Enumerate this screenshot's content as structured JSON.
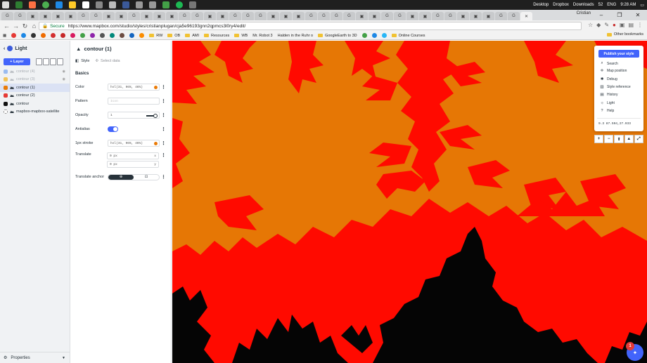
{
  "taskbar": {
    "desktop": "Desktop",
    "dropbox": "Dropbox",
    "downloads": "Downloads",
    "battery": "52",
    "lang": "ENG",
    "time": "9:28 AM"
  },
  "browser": {
    "window_name": "Cristian",
    "secure_label": "Secure",
    "url": "https://www.mapbox.com/studio/styles/cristianplugan/cja5e96193gnn2qpmcs3l0ry4/edit/",
    "bookmarks": [
      "RW",
      "OB",
      "AMI",
      "Resources",
      "WB",
      "Mr. Robot 3",
      "Halden in the Ruhr o",
      "GoogleEarth to 3D",
      "Online Courses"
    ],
    "other_bookmarks": "Other bookmarks"
  },
  "left_panel": {
    "title": "Light",
    "add_layer": "+ Layer",
    "layers": [
      {
        "name": "contour (4)",
        "color": "#9bbcf0",
        "dim": true,
        "selected": false
      },
      {
        "name": "contour (3)",
        "color": "#f2c45a",
        "dim": true,
        "selected": false
      },
      {
        "name": "contour (1)",
        "color": "#e97b07",
        "dim": false,
        "selected": true
      },
      {
        "name": "contour (2)",
        "color": "#e53935",
        "dim": false,
        "selected": false
      },
      {
        "name": "contour",
        "color": "#111111",
        "dim": false,
        "selected": false
      },
      {
        "name": "mapbox-mapbox-satellite",
        "color": "#ffffff",
        "dim": false,
        "selected": false
      }
    ],
    "footer": "Properties"
  },
  "editor": {
    "layer_title": "contour (1)",
    "tab_style": "Style",
    "tab_select": "Select data",
    "section": "Basics",
    "color_label": "Color",
    "color_value": "hsl(31, 96%, 46%)",
    "pattern_label": "Pattern",
    "pattern_placeholder": "Icon",
    "opacity_label": "Opacity",
    "opacity_value": "1",
    "antialias_label": "Antialias",
    "stroke_label": "1px stroke",
    "stroke_value": "hsl(31, 96%, 46%)",
    "translate_label": "Translate",
    "translate_x": "0 px",
    "translate_x_axis": "x",
    "translate_y": "0 px",
    "translate_y_axis": "y",
    "anchor_label": "Translate anchor"
  },
  "map_panel": {
    "publish": "Publish your style",
    "items": [
      "Search",
      "Map position",
      "Debug",
      "Style reference",
      "History",
      "Light",
      "Help"
    ],
    "coords": "9.3  87.594,27.933"
  },
  "map_controls": [
    "+",
    "−",
    "⬆",
    "▲",
    "⤢"
  ],
  "fab_badge": "1",
  "colors": {
    "accent": "#4264fb",
    "map_orange": "#e67705",
    "map_red": "#ff0a00",
    "map_black": "#050505"
  }
}
